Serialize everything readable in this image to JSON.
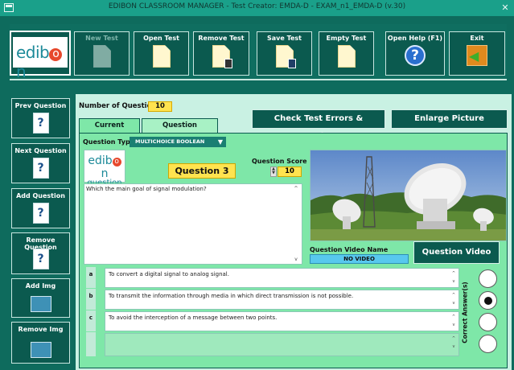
{
  "window": {
    "title": "EDIBON CLASSROOM MANAGER - Test Creator: EMDA-D - EXAM_n1_EMDA-D (v.30)"
  },
  "logo": {
    "text_prefix": "edib",
    "text_o": "o",
    "text_suffix": "n"
  },
  "toolbar": {
    "new_test": "New Test",
    "open_test": "Open Test",
    "remove_test": "Remove Test",
    "save_test": "Save Test",
    "empty_test": "Empty Test",
    "open_help": "Open Help (F1)",
    "exit": "Exit"
  },
  "sidebar": {
    "prev_question": "Prev Question",
    "next_question": "Next Question",
    "add_question": "Add Question",
    "remove_question": "Remove Question",
    "add_img": "Add Img",
    "remove_img": "Remove Img"
  },
  "header": {
    "num_questions_label": "Number of Questions",
    "num_questions_value": "10",
    "check_errors": "Check Test Errors & Warnings",
    "enlarge_picture": "Enlarge Picture"
  },
  "tabs": {
    "current": "Current Question",
    "explanation": "Question Explanation"
  },
  "question": {
    "type_label": "Question Type",
    "type_value": "MULTICHOICE BOOLEAN",
    "logo_line1_prefix": "edib",
    "logo_line1_o": "o",
    "logo_line1_suffix": "n",
    "logo_line2": "question",
    "number": "Question 3",
    "score_label": "Question Score",
    "score_value": "10",
    "text": "Which the main goal of signal modulation?",
    "video_name_label": "Question Video Name",
    "video_name_value": "NO VIDEO",
    "video_button": "Question Video"
  },
  "answers": {
    "correct_label": "Correct Answer(s)",
    "items": [
      {
        "letter": "a",
        "text": "To convert a digital signal to analog signal.",
        "checked": false
      },
      {
        "letter": "b",
        "text": "To transmit the information through media in which direct transmission is not possible.",
        "checked": true
      },
      {
        "letter": "c",
        "text": "To avoid the interception of a message between two points.",
        "checked": false
      },
      {
        "letter": "",
        "text": "",
        "checked": false
      }
    ]
  },
  "colors": {
    "dark_teal": "#0b5a4f",
    "panel_green": "#7ee7a8",
    "highlight_yellow": "#ffe34f",
    "video_blue": "#58c8ee"
  }
}
